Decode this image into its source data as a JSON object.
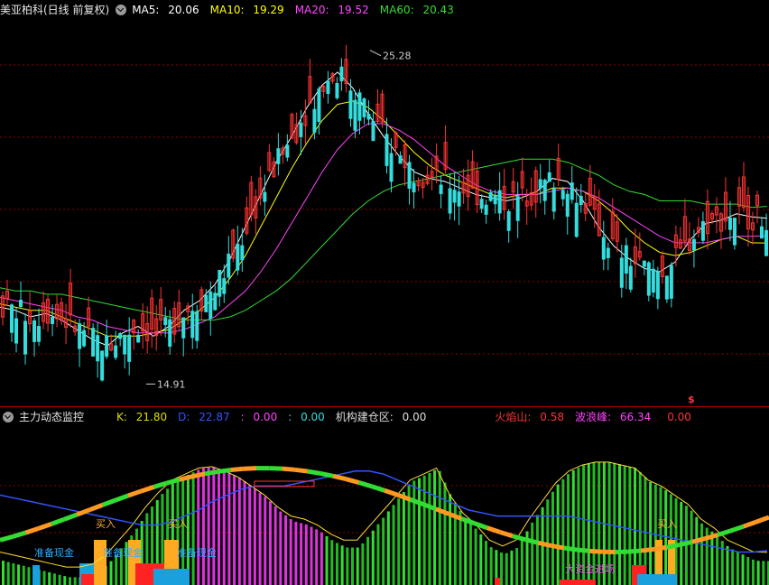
{
  "upper": {
    "title": "美亚柏科(日线 前复权)",
    "ma": [
      {
        "label": "MA5:",
        "value": "20.06",
        "color": "#ffffff"
      },
      {
        "label": "MA10:",
        "value": "19.29",
        "color": "#ffff00"
      },
      {
        "label": "MA20:",
        "value": "19.52",
        "color": "#ff44ff"
      },
      {
        "label": "MA60:",
        "value": "20.43",
        "color": "#33dd33"
      }
    ],
    "high_label": "25.28",
    "low_label": "14.91"
  },
  "lower": {
    "title": "主力动态监控",
    "stats": [
      {
        "label": "K:",
        "value": "21.80",
        "color": "#dddd00"
      },
      {
        "label": "D:",
        "value": "22.87",
        "color": "#3355ff"
      },
      {
        "label": ":",
        "value": "0.00",
        "color": "#ff44ff"
      },
      {
        "label": ":",
        "value": "0.00",
        "color": "#33dddd"
      },
      {
        "label": "机构建仓区:",
        "value": "0.00",
        "color": "#dddddd"
      },
      {
        "label": "火焰山:",
        "value": "0.58",
        "color": "#ff3333"
      },
      {
        "label": "波浪峰:",
        "value": "66.34",
        "color": "#ff44ff"
      },
      {
        "label": "",
        "value": "0.00",
        "color": "#ff3333"
      }
    ],
    "annotations": {
      "buy1": "买入",
      "buy2": "买入",
      "buy3": "买入",
      "prep1": "准备现金",
      "prep2": "准备现金",
      "prep3": "准备现金",
      "big": "大资金进场",
      "s_mark": "$"
    }
  },
  "colors": {
    "up": "#ff3333",
    "down": "#33dddd",
    "ma5": "#ffffff",
    "ma10": "#ffff00",
    "ma20": "#ff44ff",
    "ma60": "#33dd33",
    "grid": "#8b0000",
    "sep": "#aa0000"
  },
  "chart_data": [
    {
      "type": "line",
      "title": "美亚柏科(日线 前复权)",
      "ylim": [
        14.5,
        26.0
      ],
      "series": [
        {
          "name": "MA5",
          "values": [
            17.3,
            17.2,
            17.0,
            17.1,
            16.9,
            16.6,
            16.3,
            16.1,
            16.5,
            16.7,
            16.4,
            16.7,
            17.2,
            17.5,
            18.0,
            18.8,
            19.8,
            20.8,
            21.8,
            22.6,
            23.5,
            24.2,
            24.6,
            24.1,
            23.3,
            22.6,
            22.0,
            21.5,
            21.3,
            21.2,
            21.0,
            20.8,
            20.7,
            20.6,
            20.7,
            20.9,
            21.3,
            21.2,
            20.6,
            19.8,
            19.2,
            18.8,
            18.5,
            18.4,
            18.7,
            19.4,
            19.9,
            20.0,
            20.2,
            20.1,
            20.06
          ]
        },
        {
          "name": "MA10",
          "values": [
            17.4,
            17.3,
            17.2,
            17.2,
            17.0,
            16.8,
            16.6,
            16.4,
            16.4,
            16.4,
            16.5,
            16.6,
            16.9,
            17.2,
            17.6,
            18.2,
            18.9,
            19.8,
            20.7,
            21.6,
            22.4,
            23.1,
            23.6,
            23.7,
            23.5,
            23.1,
            22.6,
            22.1,
            21.7,
            21.4,
            21.2,
            21.0,
            20.8,
            20.7,
            20.8,
            20.8,
            21.0,
            21.0,
            20.9,
            20.6,
            20.2,
            19.7,
            19.3,
            19.0,
            18.9,
            19.0,
            19.2,
            19.4,
            19.5,
            19.3,
            19.29
          ]
        },
        {
          "name": "MA20",
          "values": [
            17.6,
            17.5,
            17.4,
            17.3,
            17.2,
            17.0,
            16.9,
            16.7,
            16.6,
            16.5,
            16.5,
            16.5,
            16.6,
            16.8,
            17.0,
            17.4,
            17.8,
            18.4,
            19.1,
            19.9,
            20.7,
            21.5,
            22.2,
            22.7,
            23.0,
            23.0,
            22.8,
            22.5,
            22.1,
            21.7,
            21.4,
            21.1,
            20.9,
            20.8,
            20.8,
            20.8,
            20.9,
            21.0,
            20.9,
            20.7,
            20.4,
            20.1,
            19.8,
            19.5,
            19.3,
            19.3,
            19.3,
            19.4,
            19.5,
            19.5,
            19.52
          ]
        },
        {
          "name": "MA60",
          "values": [
            17.9,
            17.8,
            17.8,
            17.7,
            17.7,
            17.6,
            17.5,
            17.4,
            17.3,
            17.2,
            17.1,
            17.0,
            16.9,
            16.9,
            16.9,
            17.0,
            17.2,
            17.5,
            17.8,
            18.2,
            18.7,
            19.2,
            19.7,
            20.2,
            20.6,
            20.9,
            21.1,
            21.2,
            21.3,
            21.4,
            21.5,
            21.6,
            21.7,
            21.8,
            21.9,
            21.9,
            21.9,
            21.8,
            21.6,
            21.4,
            21.1,
            20.9,
            20.8,
            20.6,
            20.6,
            20.6,
            20.5,
            20.5,
            20.5,
            20.4,
            20.43
          ]
        }
      ]
    },
    {
      "type": "bar",
      "title": "主力动态监控",
      "ylim": [
        0,
        100
      ],
      "series": [
        {
          "name": "K",
          "values": [
            22,
            20,
            18,
            16,
            14,
            12,
            12,
            14,
            20,
            30,
            40,
            52,
            62,
            70,
            74,
            78,
            79,
            76,
            72,
            66,
            60,
            52,
            46,
            44,
            40,
            34,
            30,
            30,
            40,
            50,
            60,
            70,
            74,
            78,
            60,
            48,
            40,
            30,
            26,
            30,
            44,
            56,
            68,
            76,
            80,
            82,
            82,
            80,
            78,
            70,
            66,
            60,
            54,
            44,
            38,
            30,
            26,
            22,
            21.8
          ]
        },
        {
          "name": "D",
          "values": [
            60,
            58,
            56,
            54,
            52,
            50,
            48,
            46,
            44,
            42,
            40,
            40,
            42,
            46,
            50,
            56,
            60,
            64,
            66,
            66,
            66,
            68,
            70,
            72,
            74,
            76,
            76,
            74,
            70,
            66,
            62,
            58,
            54,
            50,
            48,
            46,
            46,
            46,
            46,
            46,
            46,
            44,
            42,
            40,
            38,
            36,
            34,
            32,
            30,
            28,
            26,
            24,
            22,
            22,
            22.87
          ]
        }
      ]
    }
  ]
}
